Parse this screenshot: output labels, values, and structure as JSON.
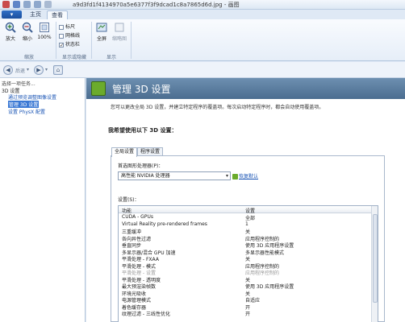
{
  "window": {
    "title": "a9d3fd1f4134970a5e6377f3f9dcad1c8a7865d6d.jpg - 画图"
  },
  "ribbon": {
    "tabs": [
      "主页",
      "查看"
    ],
    "buttons": {
      "zoom_in": "放大",
      "zoom_out": "缩小",
      "zoom_100": "100%",
      "fullscreen": "全屏",
      "thumbnail": "缩略图"
    },
    "checks": [
      {
        "label": "标尺",
        "checked": false
      },
      {
        "label": "网格线",
        "checked": false
      },
      {
        "label": "状态栏",
        "checked": true
      }
    ],
    "groups": {
      "zoom": "缩放",
      "show_hide": "显示或隐藏",
      "display": "显示"
    }
  },
  "nav": {
    "back": "后退"
  },
  "tree": {
    "root": "选择一项任务...",
    "category": "3D 设置",
    "items": [
      "通过预览调整图像设置",
      "管理 3D 设置",
      "设置 PhysX 配置"
    ]
  },
  "main": {
    "title": "管理 3D 设置",
    "description": "您可以更改全局 3D 设置，并建立特定程序的覆盖项。每次启动特定程序时，都会自动使用覆盖项。",
    "section_title": "我希望使用以下 3D 设置：",
    "tabs": [
      "全局设置",
      "程序设置"
    ],
    "preferred_label": "首选图形处理器(P)：",
    "preferred_value": "高性能 NVIDIA 处理器",
    "restore_link": "恢复默认",
    "settings_label": "设置(S)：",
    "columns": {
      "feature": "功能",
      "setting": "设置"
    },
    "rows": [
      {
        "feature": "CUDA - GPUs",
        "setting": "全部",
        "disabled": false
      },
      {
        "feature": "Virtual Reality pre-rendered frames",
        "setting": "1",
        "disabled": false
      },
      {
        "feature": "三重缓冲",
        "setting": "关",
        "disabled": false
      },
      {
        "feature": "各向异性过滤",
        "setting": "应用程序控制的",
        "disabled": false
      },
      {
        "feature": "垂直同步",
        "setting": "使用 3D 应用程序设置",
        "disabled": false
      },
      {
        "feature": "多显示器/混合 GPU 加速",
        "setting": "多显示器性能模式",
        "disabled": false
      },
      {
        "feature": "平滑处理 - FXAA",
        "setting": "关",
        "disabled": false
      },
      {
        "feature": "平滑处理 - 模式",
        "setting": "应用程序控制的",
        "disabled": false
      },
      {
        "feature": "平滑处理 - 设置",
        "setting": "应用程序控制的",
        "disabled": true
      },
      {
        "feature": "平滑处理 - 透明度",
        "setting": "关",
        "disabled": false
      },
      {
        "feature": "最大预渲染帧数",
        "setting": "使用 3D 应用程序设置",
        "disabled": false
      },
      {
        "feature": "环境光吸收",
        "setting": "关",
        "disabled": false
      },
      {
        "feature": "电源管理模式",
        "setting": "自适应",
        "disabled": false
      },
      {
        "feature": "着色缓存器",
        "setting": "开",
        "disabled": false
      },
      {
        "feature": "纹理过滤 - 三线性优化",
        "setting": "开",
        "disabled": false
      }
    ]
  },
  "colors": {
    "accent": "#3a78d4",
    "header": "#5a7ca0",
    "nvidia_green": "#6bab2c"
  }
}
